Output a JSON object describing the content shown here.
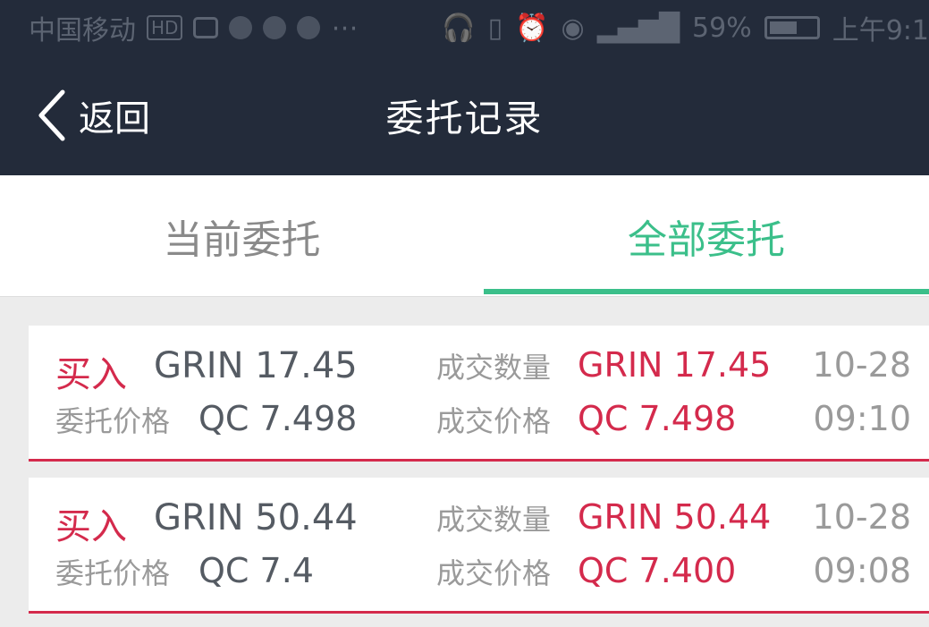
{
  "status_bar": {
    "carrier": "中国移动",
    "network_badge": "HD",
    "battery_percent": "59%",
    "time": "上午9:1"
  },
  "header": {
    "back_label": "返回",
    "title": "委托记录"
  },
  "tabs": [
    {
      "label": "当前委托",
      "active": false
    },
    {
      "label": "全部委托",
      "active": true
    }
  ],
  "orders": [
    {
      "side": "买入",
      "amount": "GRIN 17.45",
      "entrust_price_label": "委托价格",
      "entrust_price": "QC 7.498",
      "filled_qty_label": "成交数量",
      "filled_qty": "GRIN 17.45",
      "filled_price_label": "成交价格",
      "filled_price": "QC 7.498",
      "date": "10-28",
      "time": "09:10"
    },
    {
      "side": "买入",
      "amount": "GRIN 50.44",
      "entrust_price_label": "委托价格",
      "entrust_price": "QC 7.4",
      "filled_qty_label": "成交数量",
      "filled_qty": "GRIN 50.44",
      "filled_price_label": "成交价格",
      "filled_price": "QC 7.400",
      "date": "10-28",
      "time": "09:08"
    }
  ],
  "colors": {
    "header_bg": "#232b3a",
    "accent_green": "#3bbf8a",
    "buy_red": "#d42a4c"
  }
}
